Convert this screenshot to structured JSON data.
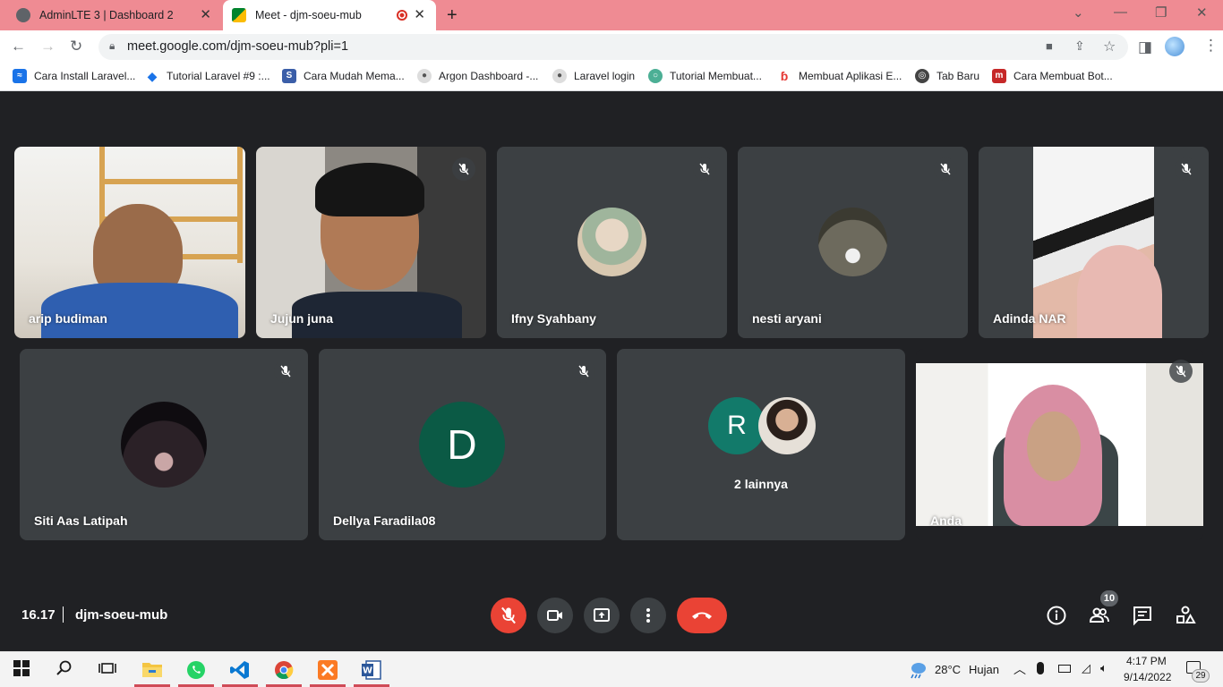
{
  "browser": {
    "tabs": [
      {
        "title": "AdminLTE 3 | Dashboard 2"
      },
      {
        "title": "Meet - djm-soeu-mub"
      }
    ],
    "url": "meet.google.com/djm-soeu-mub?pli=1"
  },
  "bookmarks": [
    {
      "label": "Cara Install Laravel...",
      "icon": "blue",
      "color": "#1a73e8"
    },
    {
      "label": "Tutorial Laravel #9 :...",
      "icon": "diamond",
      "color": "#1a73e8"
    },
    {
      "label": "Cara Mudah Mema...",
      "icon": "S",
      "color": "#3b5ea8"
    },
    {
      "label": "Argon Dashboard -...",
      "icon": "avatar",
      "color": "#555"
    },
    {
      "label": "Laravel login",
      "icon": "avatar",
      "color": "#555"
    },
    {
      "label": "Tutorial Membuat...",
      "icon": "round",
      "color": "#4caf95"
    },
    {
      "label": "Membuat Aplikasi E...",
      "icon": "red-b",
      "color": "#e53935"
    },
    {
      "label": "Tab Baru",
      "icon": "globe",
      "color": "#444"
    },
    {
      "label": "Cara Membuat Bot...",
      "icon": "m",
      "color": "#c62828"
    }
  ],
  "participants": [
    {
      "name": "arip budiman",
      "muted": false,
      "video": true
    },
    {
      "name": "Jujun juna",
      "muted": true,
      "video": true
    },
    {
      "name": "Ifny Syahbany",
      "muted": true,
      "video": false
    },
    {
      "name": "nesti aryani",
      "muted": true,
      "video": false
    },
    {
      "name": "Adinda NAR",
      "muted": true,
      "video": true
    },
    {
      "name": "Siti Aas Latipah",
      "muted": true,
      "video": false
    },
    {
      "name": "Dellya Faradila08",
      "muted": true,
      "video": false,
      "initial": "D"
    },
    {
      "name": "2 lainnya",
      "muted": false,
      "video": false,
      "initial": "R"
    },
    {
      "name": "Anda",
      "muted": true,
      "video": true
    }
  ],
  "meeting": {
    "time": "16.17",
    "code": "djm-soeu-mub",
    "people_count": "10"
  },
  "taskbar": {
    "weather_temp": "28°C",
    "weather_desc": "Hujan",
    "time": "4:17 PM",
    "date": "9/14/2022",
    "notifications": "29"
  },
  "colors": {
    "tabbar": "#ef8b93",
    "meet_bg": "#202124",
    "tile_bg": "#3c4043",
    "end_call": "#ea4335",
    "avatar_green": "#0b5a45"
  }
}
